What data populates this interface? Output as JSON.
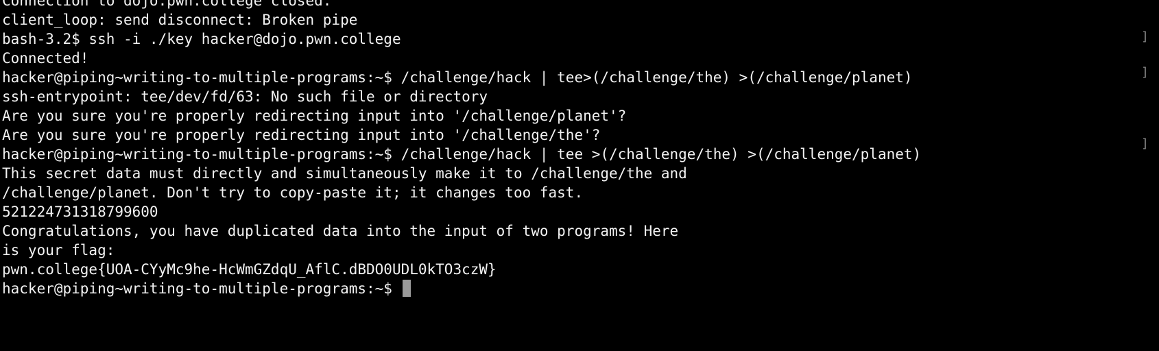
{
  "terminal": {
    "background": "#000000",
    "foreground": "#f2f2f2",
    "cursor_color": "#9a9a9a",
    "lines": [
      "Connection to dojo.pwn.college closed.",
      "client_loop: send disconnect: Broken pipe",
      "bash-3.2$ ssh -i ./key hacker@dojo.pwn.college",
      "Connected!",
      "hacker@piping~writing-to-multiple-programs:~$ /challenge/hack | tee>(/challenge/the) >(/challenge/planet)",
      "ssh-entrypoint: tee/dev/fd/63: No such file or directory",
      "Are you sure you're properly redirecting input into '/challenge/planet'?",
      "Are you sure you're properly redirecting input into '/challenge/the'?",
      "hacker@piping~writing-to-multiple-programs:~$ /challenge/hack | tee >(/challenge/the) >(/challenge/planet)",
      "This secret data must directly and simultaneously make it to /challenge/the and",
      "/challenge/planet. Don't try to copy-paste it; it changes too fast.",
      "521224731318799600",
      "Congratulations, you have duplicated data into the input of two programs! Here",
      "is your flag:",
      "pwn.college{UOA-CYyMc9he-HcWmGZdqU_AflC.dBDO0UDL0kTO3czW}",
      "hacker@piping~writing-to-multiple-programs:~$ "
    ],
    "prompt_marks": [
      "]",
      "]",
      "]"
    ]
  }
}
